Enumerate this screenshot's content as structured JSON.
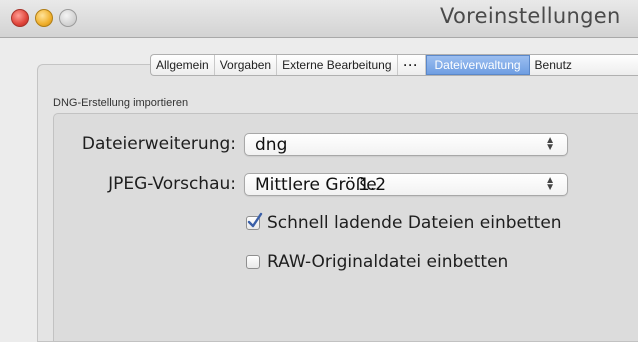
{
  "window": {
    "title": "Voreinstellungen"
  },
  "tabs": [
    {
      "label": "Allgemein"
    },
    {
      "label": "Vorgaben"
    },
    {
      "label": "Externe Bearbeitung"
    },
    {
      "label": "···"
    },
    {
      "label": "Dateiverwaltung",
      "selected": true
    },
    {
      "label": "Benutz"
    }
  ],
  "section": {
    "label": "DNG-Erstellung importieren"
  },
  "fields": {
    "extension_label": "Dateierweiterung:",
    "extension_value": "dng",
    "preview_label": "JPEG-Vorschau:",
    "preview_value": "Mittlere Größe",
    "preview_value_overlay": "1.2"
  },
  "checkboxes": [
    {
      "label": "Schnell ladende Dateien einbetten",
      "checked": true
    },
    {
      "label": "RAW-Originaldatei einbetten",
      "checked": false
    }
  ],
  "colors": {
    "selected_tab": "#6f9ee2",
    "check_mark": "#3a5fa8"
  },
  "icons": {
    "popup_arrows": "up-down-chevrons-icon",
    "checkmark": "checkmark-icon"
  }
}
